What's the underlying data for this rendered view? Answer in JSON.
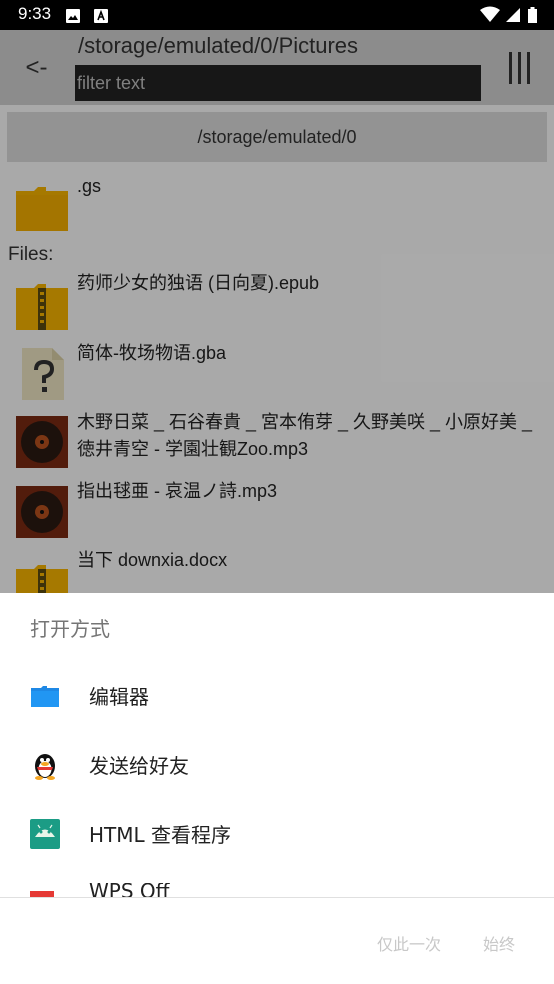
{
  "status_bar": {
    "time": "9:33",
    "icons": [
      "image-icon",
      "a-letter-icon",
      "wifi-icon",
      "signal-icon",
      "battery-icon"
    ]
  },
  "file_browser": {
    "back_label": "<-",
    "path_title": "/storage/emulated/0/Pictures",
    "filter_placeholder": "filter text",
    "parent_path": "/storage/emulated/0",
    "folders": [
      {
        "name": ".gs",
        "icon": "folder-icon"
      }
    ],
    "files_label": "Files:",
    "files": [
      {
        "name": "药师少女的独语 (日向夏).epub",
        "icon": "archive-icon"
      },
      {
        "name": "简体-牧场物语.gba",
        "icon": "unknown-file-icon"
      },
      {
        "name": "木野日菜 _ 石谷春貴 _ 宮本侑芽 _ 久野美咲 _ 小原好美 _ 徳井青空 - 学園壮観Zoo.mp3",
        "icon": "audio-file-icon"
      },
      {
        "name": "指出毬亜 - 哀温ノ詩.mp3",
        "icon": "audio-file-icon"
      },
      {
        "name": "当下 downxia.docx",
        "icon": "archive-icon"
      }
    ]
  },
  "open_with_sheet": {
    "title": "打开方式",
    "apps": [
      {
        "label": "编辑器",
        "icon": "folder-icon"
      },
      {
        "label": "发送给好友",
        "icon": "qq-penguin-icon"
      },
      {
        "label": "HTML 查看程序",
        "icon": "android-icon"
      },
      {
        "label": "WPS Off",
        "icon": "wps-icon"
      }
    ],
    "just_once_label": "仅此一次",
    "always_label": "始终"
  },
  "colors": {
    "folder": "#f5b301",
    "accent_blue": "#1e88e5",
    "android_green": "#1b9c85",
    "scrim": "rgba(0,0,0,0.32)"
  }
}
